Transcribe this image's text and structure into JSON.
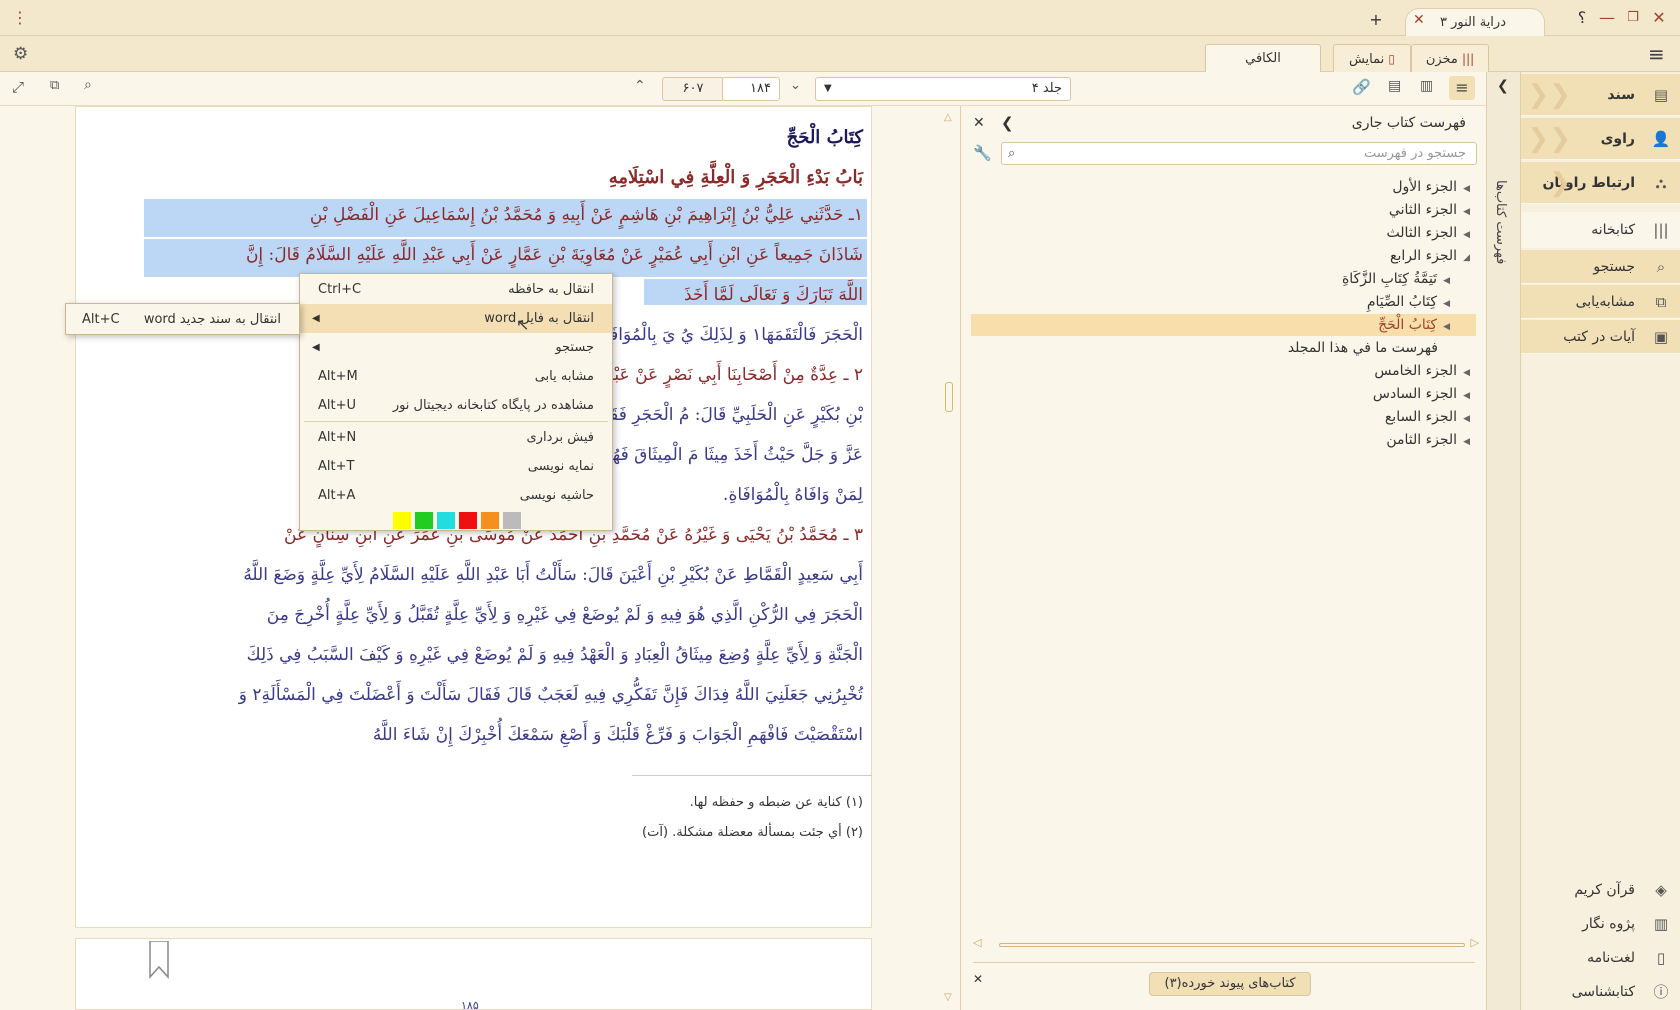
{
  "titlebar": {
    "app_tab": "دراية النور ٣",
    "help": "؟",
    "new_tab": "+",
    "tab_close": "✕",
    "menu_dots": "⋮"
  },
  "tabs_row": {
    "makhzan": "مخزن",
    "namayesh": "نمایش",
    "book_tab": "الكافي"
  },
  "toolbar": {
    "volume": "جلد ۴",
    "page_current": "۱۸۴",
    "page_total": "۶۰۷"
  },
  "sidebar": {
    "sanad": "سند",
    "ravi": "راوی",
    "ertebat": "ارتباط راویان",
    "ketabkhane": "کتابخانه",
    "jostejoo": "جستجو",
    "moshabeh": "مشابه‌یابی",
    "ayat": "آیات در کتب",
    "quran": "قرآن کریم",
    "pajoohe": "پژوه نگار",
    "loghat": "لغت‌نامه",
    "ketabshenasi": "کتابشناسی"
  },
  "vstrip": {
    "label": "فهرست کتاب‌ها"
  },
  "toc": {
    "title": "فهرست کتاب جاری",
    "search_placeholder": "جستجو در فهرست",
    "items": [
      "الجزء الأول",
      "الجزء الثاني",
      "الجزء الثالث",
      "الجزء الرابع",
      "تَتِمَّةُ كِتَابِ الزَّكَاةِ",
      "كِتَابُ الصِّيَامِ",
      "كِتَابُ الْحَجِّ",
      "فهرست ما في هذا المجلد",
      "الجزء الخامس",
      "الجزء السادس",
      "الجزء السابع",
      "الجزء الثامن"
    ],
    "linked_books": "کتاب‌های پیوند خورده(۳)"
  },
  "book": {
    "title1": "كِتَابُ الْحَجِّ",
    "title2": "بَابُ بَدْءِ الْحَجَرِ وَ الْعِلَّةِ فِي اسْتِلَامِهِ",
    "lines": [
      "١ـ حَدَّثَنِي عَلِيُّ بْنُ إِبْرَاهِيمَ بْنِ هَاشِمٍ عَنْ أَبِيهِ وَ مُحَمَّدُ بْنُ إِسْمَاعِيلَ عَنِ الْفَضْلِ بْنِ",
      "شَاذَانَ جَمِيعاً عَنِ ابْنِ أَبِي عُمَيْرٍ عَنْ مُعَاوِيَةَ بْنِ عَمَّارٍ عَنْ أَبِي عَبْدِ اللَّهِ عَلَيْهِ السَّلَامُ قَالَ: إِنَّ",
      "اللَّهَ تَبَارَكَ وَ تَعَالَى لَمَّا أَخَذَ",
      "الْحَجَرَ فَالْتَقَمَهَا١ وَ لِذَلِكَ يُ                      يَ بِالْمُوَافَاةِ.",
      "٢ ـ عِدَّةٌ مِنْ أَصْحَابِنَا                      أَبِي نَصْرٍ عَنْ عَبْدِ اللَّهِ",
      "بْنِ بُكَيْرٍ عَنِ الْحَلَبِيِّ قَالَ:                      مُ الْحَجَرِ فَقَالَ إِنَّ اللَّهَ",
      "عَزَّ وَ جَلَّ حَيْثُ أَخَذَ مِيثَا                      مَ الْمِيثَاقَ فَهُوَ يَشْهَدُ",
      "لِمَنْ وَافَاهُ بِالْمُوَافَاةِ.",
      "٣ ـ مُحَمَّدُ بْنُ يَحْيَى وَ غَيْرُهُ عَنْ مُحَمَّدِ بْنِ أَحْمَدَ عَنْ مُوسَى بْنِ عُمَرَ عَنِ ابْنِ سِنَانٍ عَنْ",
      "أَبِي سَعِيدٍ الْقَمَّاطِ عَنْ بُكَيْرِ بْنِ أَعْيَنَ قَالَ: سَأَلْتُ أَبَا عَبْدِ اللَّهِ عَلَيْهِ السَّلَامُ لِأَيِّ عِلَّةٍ وَضَعَ اللَّهُ",
      "الْحَجَرَ فِي الرُّكْنِ الَّذِي هُوَ فِيهِ وَ لَمْ يُوضَعْ فِي غَيْرِهِ وَ لِأَيِّ عِلَّةٍ تُقَبَّلُ وَ لِأَيِّ عِلَّةٍ أُخْرِجَ مِنَ",
      "الْجَنَّةِ وَ لِأَيِّ عِلَّةٍ وُضِعَ مِيثَاقُ الْعِبَادِ وَ الْعَهْدُ فِيهِ وَ لَمْ يُوضَعْ فِي غَيْرِهِ وَ كَيْفَ السَّبَبُ فِي ذَلِكَ",
      "تُخْبِرُنِي جَعَلَنِيَ اللَّهُ فِدَاكَ فَإِنَّ تَفَكُّرِي فِيهِ لَعَجَبٌ قَالَ فَقَالَ سَأَلْتَ وَ أَعْضَلْتَ فِي الْمَسْأَلَةِ٢ وَ",
      "اسْتَقْصَيْتَ فَافْهَمِ الْجَوَابَ وَ فَرِّغْ قَلْبَكَ وَ أَصْغِ سَمْعَكَ أُخْبِرْكَ إِنْ شَاءَ اللَّهُ"
    ],
    "fn1": "(١)  كناية عن ضبطه و حفظه لها.",
    "fn2": "(٢)  أي جئت بمسألة معضلة مشكلة. (آت)",
    "page_num": "۱۸۵"
  },
  "context_menu": {
    "items": [
      {
        "label": "انتقال به حافظه",
        "shortcut": "Ctrl+C"
      },
      {
        "label": "انتقال به فایل word",
        "shortcut": ""
      },
      {
        "label": "جستجو",
        "shortcut": ""
      },
      {
        "label": "مشابه یابی",
        "shortcut": "Alt+M"
      },
      {
        "label": "مشاهده در پایگاه کتابخانه دیجیتال نور",
        "shortcut": "Alt+U"
      },
      {
        "label": "فیش برداری",
        "shortcut": "Alt+N"
      },
      {
        "label": "نمایه نویسی",
        "shortcut": "Alt+T"
      },
      {
        "label": "حاشیه نویسی",
        "shortcut": "Alt+A"
      }
    ],
    "colors": [
      "#ffff00",
      "#22cc22",
      "#22dddd",
      "#ee1111",
      "#f5901e",
      "#bbbbbb"
    ],
    "submenu": {
      "label": "انتقال به سند جدید word",
      "shortcut": "Alt+C"
    }
  },
  "colors": {
    "accent": "#a0442d",
    "sidebar_active": "#f1dfb6",
    "highlight": "#bcd7f5"
  }
}
